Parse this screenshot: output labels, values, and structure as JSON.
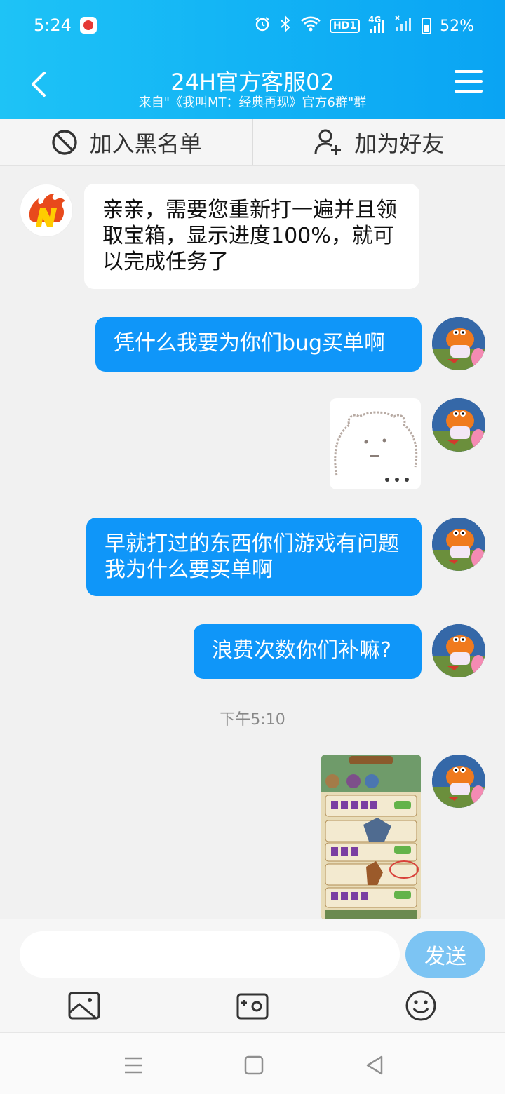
{
  "status_bar": {
    "time": "5:24",
    "battery": "52%",
    "hd_label": "HD1",
    "net_label": "4G",
    "icons": [
      "app-badge-icon",
      "alarm-icon",
      "bluetooth-icon",
      "wifi-icon",
      "hd-icon",
      "signal-icon",
      "no-signal-icon",
      "battery-icon"
    ]
  },
  "header": {
    "title": "24H官方客服02",
    "subtitle": "来自\"《我叫MT：经典再现》官方6群\"群"
  },
  "actions": {
    "blacklist_label": "加入黑名单",
    "add_friend_label": "加为好友"
  },
  "messages": [
    {
      "from": "agent",
      "type": "text",
      "text": "亲亲，需要您重新打一遍并且领取宝箱，显示进度100%，就可以完成任务了"
    },
    {
      "from": "me",
      "type": "text",
      "text": "凭什么我要为你们bug买单啊"
    },
    {
      "from": "me",
      "type": "sticker"
    },
    {
      "from": "me",
      "type": "text",
      "text": "早就打过的东西你们游戏有问题我为什么要买单啊"
    },
    {
      "from": "me",
      "type": "text",
      "text": "浪费次数你们补嘛?"
    },
    {
      "from": "me",
      "type": "image"
    }
  ],
  "timestamp": "下午5:10",
  "composer": {
    "placeholder": "",
    "send_label": "发送",
    "tools": [
      "gallery-icon",
      "camera-icon",
      "emoji-icon"
    ]
  },
  "colors": {
    "header_start": "#1ec3f6",
    "header_end": "#0aa4f3",
    "outgoing_bubble": "#0f96f9",
    "incoming_bubble": "#ffffff",
    "send_button": "#7cc4f3",
    "background": "#f1f1f1"
  }
}
